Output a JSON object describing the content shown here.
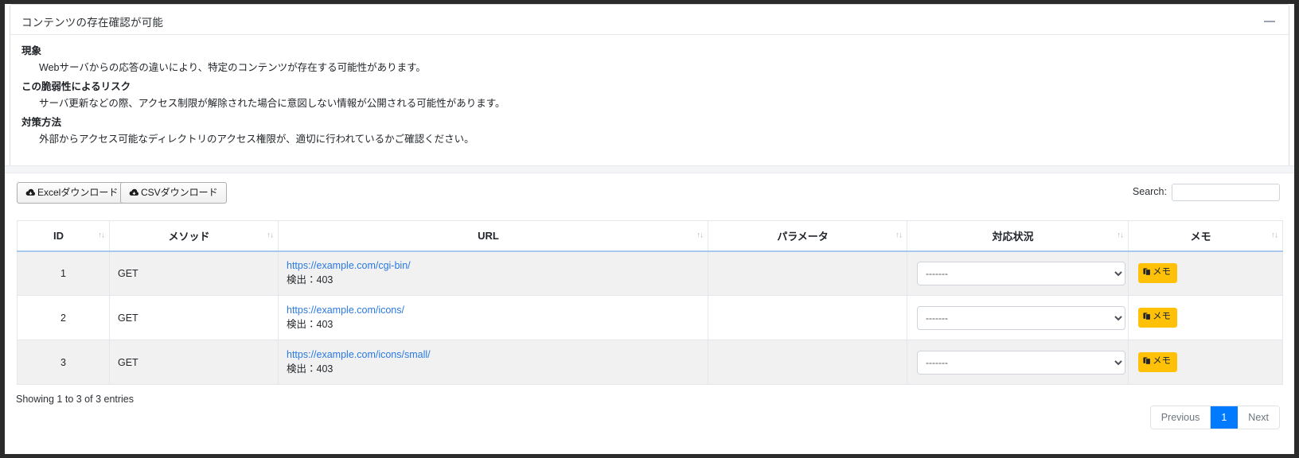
{
  "card": {
    "title": "コンテンツの存在確認が可能",
    "collapse_icon": "minus-icon",
    "sections": [
      {
        "heading": "現象",
        "text": "Webサーバからの応答の違いにより、特定のコンテンツが存在する可能性があります。"
      },
      {
        "heading": "この脆弱性によるリスク",
        "text": "サーバ更新などの際、アクセス制限が解除された場合に意図しない情報が公開される可能性があります。"
      },
      {
        "heading": "対策方法",
        "text": "外部からアクセス可能なディレクトリのアクセス権限が、適切に行われているかご確認ください。"
      }
    ]
  },
  "toolbar": {
    "excel_label": "Excelダウンロード",
    "csv_label": "CSVダウンロード",
    "download_icon": "cloud-download-icon",
    "search_label": "Search:",
    "search_value": "",
    "search_placeholder": ""
  },
  "table": {
    "sort_icon": "sort-updown-icon",
    "columns": [
      {
        "key": "id",
        "label": "ID"
      },
      {
        "key": "method",
        "label": "メソッド"
      },
      {
        "key": "url",
        "label": "URL"
      },
      {
        "key": "param",
        "label": "パラメータ"
      },
      {
        "key": "status",
        "label": "対応状況"
      },
      {
        "key": "memo",
        "label": "メモ"
      }
    ],
    "rows": [
      {
        "id": "1",
        "method": "GET",
        "url": "https://example.com/cgi-bin/",
        "detect": "検出：403",
        "param": "",
        "status_selected": "-------",
        "memo_label": "メモ",
        "memo_icon": "clipboard-icon"
      },
      {
        "id": "2",
        "method": "GET",
        "url": "https://example.com/icons/",
        "detect": "検出：403",
        "param": "",
        "status_selected": "-------",
        "memo_label": "メモ",
        "memo_icon": "clipboard-icon"
      },
      {
        "id": "3",
        "method": "GET",
        "url": "https://example.com/icons/small/",
        "detect": "検出：403",
        "param": "",
        "status_selected": "-------",
        "memo_label": "メモ",
        "memo_icon": "clipboard-icon"
      }
    ],
    "status_options": [
      "-------"
    ]
  },
  "footer": {
    "info": "Showing 1 to 3 of 3 entries",
    "pagination": {
      "previous": "Previous",
      "current_page": "1",
      "next": "Next"
    }
  },
  "colors": {
    "link": "#2a7ae2",
    "memo_button": "#ffc107",
    "active_page": "#007bff",
    "header_underline": "#a8c8ee",
    "odd_row": "#f1f1f1"
  }
}
